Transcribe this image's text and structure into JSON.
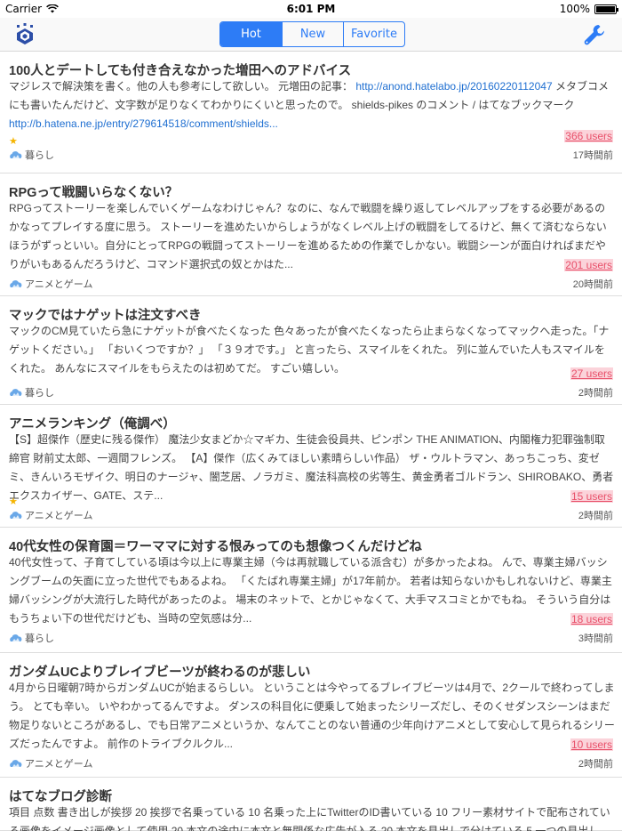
{
  "status_bar": {
    "carrier": "Carrier",
    "time": "6:01 PM",
    "battery": "100%",
    "battery_level": 1.0
  },
  "nav": {
    "segments": [
      {
        "label": "Hot",
        "active": true
      },
      {
        "label": "New",
        "active": false
      },
      {
        "label": "Favorite",
        "active": false
      }
    ],
    "accent_color": "#2d7cf6"
  },
  "entries": [
    {
      "title": "100人とデートしても付き合えなかった増田へのアドバイス",
      "summary_before": "マジレスで解決策を書く。他の人も参考にして欲しい。 元増田の記事： ",
      "link1": "http://anond.hatelabo.jp/20160220112047",
      "summary_middle": " メタブコメにも書いたんだけど、文字数が足りなくてわかりにくいと思ったので。 shields-pikes のコメント / はてなブックマーク ",
      "link2": "http://b.hatena.ne.jp/entry/279614518/comment/shields...",
      "starred": true,
      "users": "366 users",
      "category": "暮らし",
      "time": "17時間前"
    },
    {
      "title": "RPGって戦闘いらなくない？",
      "summary_before": "RPGってストーリーを楽しんでいくゲームなわけじゃん？なのに、なんで戦闘を繰り返してレベルアップをする必要があるのかなってプレイする度に思う。 ストーリーを進めたいからしょうがなくレベル上げの戦闘をしてるけど、無くて済むならないほうがずっといい。自分にとってRPGの戦闘ってストーリーを進めるための作業でしかない。戦闘シーンが面白ければまだやりがいもあるんだろうけど、コマンド選択式の奴とかはた...",
      "starred": false,
      "users": "201 users",
      "category": "アニメとゲーム",
      "time": "20時間前"
    },
    {
      "title": "マックではナゲットは注文すべき",
      "summary_before": "マックのCM見ていたら急にナゲットが食べたくなった 色々あったが食べたくなったら止まらなくなってマックへ走った。「ナゲットください。」 「おいくつですか？」 「３９才です。」 と言ったら、スマイルをくれた。 列に並んでいた人もスマイルをくれた。 あんなにスマイルをもらえたのは初めてだ。 すごい嬉しい。",
      "starred": false,
      "users": "27 users",
      "category": "暮らし",
      "time": "2時間前"
    },
    {
      "title": "アニメランキング（俺調べ）",
      "summary_before": "【S】超傑作（歴史に残る傑作） 魔法少女まどか☆マギカ、生徒会役員共、ピンポン THE ANIMATION、内閣権力犯罪強制取締官 財前丈太郎、一週間フレンズ。 【A】傑作（広くみてほしい素晴らしい作品） ザ・ウルトラマン、あっちこっち、変ゼミ、きんいろモザイク、明日のナージャ、闇芝居、ノラガミ、魔法科高校の劣等生、黄金勇者ゴルドラン、SHIROBAKO、勇者エクスカイザー、GATE、ステ...",
      "starred": true,
      "users": "15 users",
      "category": "アニメとゲーム",
      "time": "2時間前"
    },
    {
      "title": "40代女性の保育園＝ワーママに対する恨みってのも想像つくんだけどね",
      "summary_before": "40代女性って、子育てしている頃は今以上に専業主婦（今は再就職している派含む）が多かったよね。 んで、専業主婦バッシングブームの矢面に立った世代でもあるよね。 「くたばれ専業主婦」が17年前か。 若者は知らないかもしれないけど、専業主婦バッシングが大流行した時代があったのよ。 場末のネットで、とかじゃなくて、大手マスコミとかでもね。 そういう自分はもうちょい下の世代だけども、当時の空気感は分...",
      "starred": false,
      "users": "18 users",
      "category": "暮らし",
      "time": "3時間前"
    },
    {
      "title": "ガンダムUCよりブレイブビーツが終わるのが悲しい",
      "summary_before": "4月から日曜朝7時からガンダムUCが始まるらしい。 ということは今やってるブレイブビーツは4月で、2クールで終わってしまう。 とても辛い。 いやわかってるんですよ。 ダンスの科目化に便乗して始まったシリーズだし、そのくせダンスシーンはまだ物足りないところがあるし、でも日常アニメというか、なんてことのない普通の少年向けアニメとして安心して見られるシリーズだったんですよ。 前作のトライブクルクル...",
      "starred": false,
      "users": "10 users",
      "category": "アニメとゲーム",
      "time": "2時間前"
    },
    {
      "title": "はてなブログ診断",
      "summary_before": "項目 点数 書き出しが挨拶 20 挨拶で名乗っている 10 名乗った上にTwitterのID書いている 10 フリー素材サイトで配布されている画像をイメージ画像として使用 20 本文の途中に本文と無関係な広告が入る 20 本文を見出しで分けている 5 一つの見出し",
      "starred": false,
      "users": "",
      "category": "",
      "time": ""
    }
  ]
}
